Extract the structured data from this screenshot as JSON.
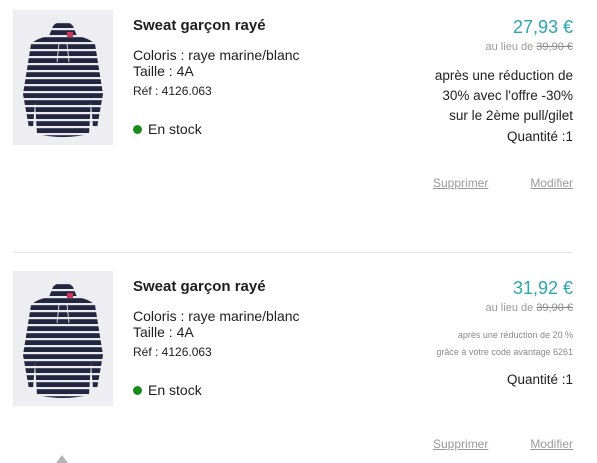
{
  "cart": {
    "items": [
      {
        "title": "Sweat garçon rayé",
        "color": "Coloris : raye marine/blanc",
        "size": "Taille : 4A",
        "ref": "Réf : 4126.063",
        "stock": "En stock",
        "price": "27,93 €",
        "was_prefix": "au lieu de",
        "was_price": "39,90 €",
        "discount_lines": [
          "après une réduction de",
          "30% avec l'offre -30%",
          "sur le 2ème pull/gilet"
        ],
        "quantity": "Quantité :1",
        "remove_label": "Supprimer",
        "edit_label": "Modifier"
      },
      {
        "title": "Sweat garçon rayé",
        "color": "Coloris : raye marine/blanc",
        "size": "Taille : 4A",
        "ref": "Réf : 4126.063",
        "stock": "En stock",
        "price": "31,92 €",
        "was_prefix": "au lieu de",
        "was_price": "39,90 €",
        "discount_lines": [
          "après une réduction de 20 %",
          "grâce à votre code avantage 6261"
        ],
        "quantity": "Quantité :1",
        "remove_label": "Supprimer",
        "edit_label": "Modifier"
      }
    ]
  },
  "colors": {
    "price": "#2aa7ae",
    "stock_dot": "#1a8a1a",
    "muted": "#9a9a9a",
    "text": "#1e1e1e"
  }
}
